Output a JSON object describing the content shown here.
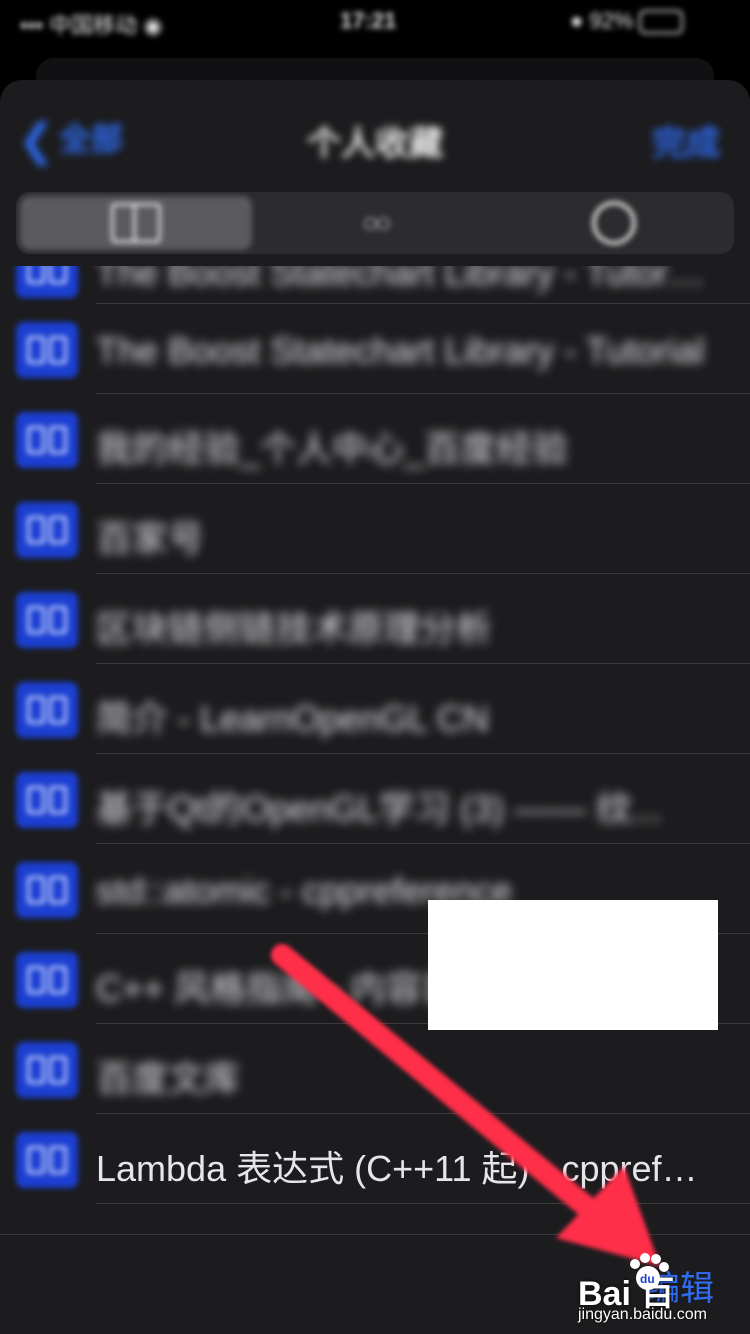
{
  "status_bar": {
    "carrier": "••• 中国移动 ◉",
    "time": "17:21",
    "battery": "● 92%"
  },
  "nav": {
    "back_label": "全部",
    "title": "个人收藏",
    "done_label": "完成"
  },
  "segments": [
    {
      "name": "bookmarks-icon",
      "active": true
    },
    {
      "name": "reading-list-icon",
      "active": false
    },
    {
      "name": "history-icon",
      "active": false
    }
  ],
  "bookmarks": [
    {
      "title": "The Boost Statechart Library - Tutoria...",
      "blurred": true
    },
    {
      "title": "The Boost Statechart Library - Tutorial",
      "blurred": true
    },
    {
      "title": "我的经验_个人中心_百度经验",
      "blurred": true
    },
    {
      "title": "百家号",
      "blurred": true
    },
    {
      "title": "区块链侧链技术原理分析",
      "blurred": true
    },
    {
      "title": "简介 - LearnOpenGL CN",
      "blurred": true
    },
    {
      "title": "基于Qt的OpenGL学习 (3) —— 纹...",
      "blurred": true
    },
    {
      "title": "std::atomic - cppreference",
      "blurred": true
    },
    {
      "title": "C++ 风格指南 - 内容目录",
      "blurred": true
    },
    {
      "title": "百度文库",
      "blurred": true
    },
    {
      "title": "Lambda 表达式 (C++11 起) - cppreference...",
      "blurred": false
    }
  ],
  "toolbar": {
    "edit_label": "编辑"
  },
  "watermark": {
    "logo": "Bai  百",
    "paw": "du",
    "url": "jingyan.baidu.com"
  },
  "colors": {
    "accent": "#2f6df5",
    "annotation_arrow": "#ff2d4a"
  }
}
